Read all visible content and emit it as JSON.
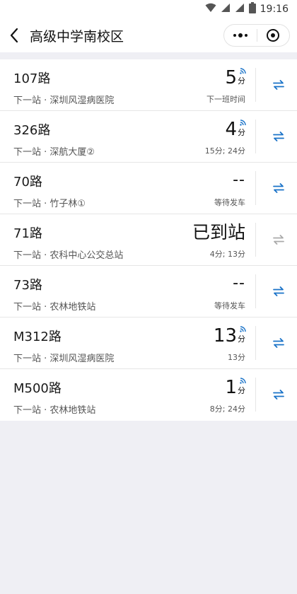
{
  "status_bar": {
    "time": "19:16"
  },
  "header": {
    "title": "高级中学南校区"
  },
  "routes": [
    {
      "name": "107路",
      "next_stop": "下一站 · 深圳风湿病医院",
      "eta": "5",
      "unit": "分",
      "sub": "下一班时间",
      "state": "live"
    },
    {
      "name": "326路",
      "next_stop": "下一站 · 深航大厦②",
      "eta": "4",
      "unit": "分",
      "sub": "15分; 24分",
      "state": "live"
    },
    {
      "name": "70路",
      "next_stop": "下一站 · 竹子林①",
      "eta": "--",
      "unit": "",
      "sub": "等待发车",
      "state": "waiting"
    },
    {
      "name": "71路",
      "next_stop": "下一站 · 农科中心公交总站",
      "eta": "已到站",
      "unit": "",
      "sub": "4分; 13分",
      "state": "arrived"
    },
    {
      "name": "73路",
      "next_stop": "下一站 · 农林地铁站",
      "eta": "--",
      "unit": "",
      "sub": "等待发车",
      "state": "waiting"
    },
    {
      "name": "M312路",
      "next_stop": "下一站 · 深圳风湿病医院",
      "eta": "13",
      "unit": "分",
      "sub": "13分",
      "state": "live"
    },
    {
      "name": "M500路",
      "next_stop": "下一站 · 农林地铁站",
      "eta": "1",
      "unit": "分",
      "sub": "8分; 24分",
      "state": "live"
    }
  ],
  "colors": {
    "accent": "#1a73c8",
    "muted_icon": "#aaaaaa"
  }
}
